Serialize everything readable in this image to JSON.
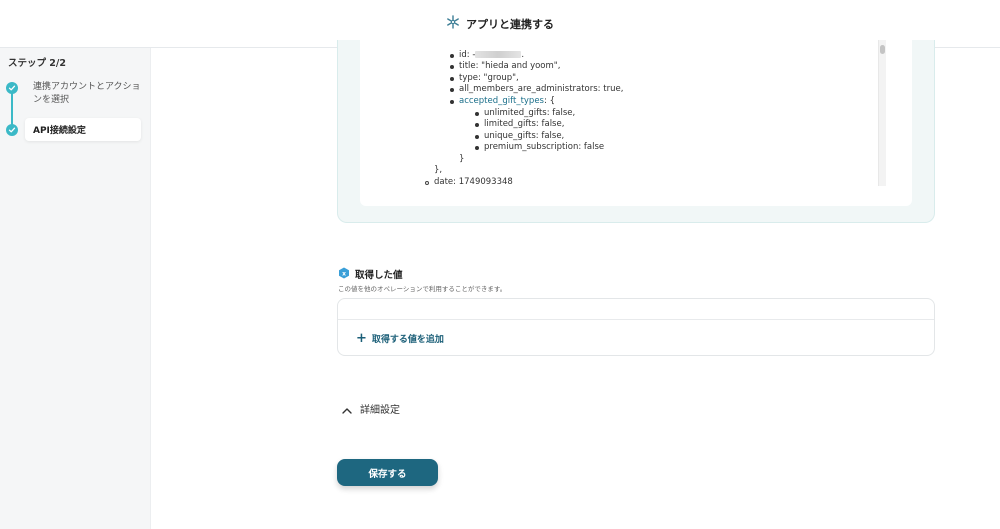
{
  "header": {
    "title": "アプリと連携する",
    "icon": "sparkle-icon"
  },
  "sidebar": {
    "step_label": "ステップ 2/2",
    "steps": [
      {
        "label": "連携アカウントとアクションを選択",
        "status": "completed"
      },
      {
        "label": "API接続設定",
        "status": "active"
      }
    ]
  },
  "code_preview": {
    "lines": [
      {
        "bullet": "filled",
        "parts": [
          {
            "text": "id: -"
          },
          {
            "blur": true
          },
          {
            "text": "."
          }
        ]
      },
      {
        "bullet": "filled",
        "parts": [
          {
            "text": "title: \"hieda and yoom\","
          }
        ]
      },
      {
        "bullet": "filled",
        "parts": [
          {
            "text": "type: \"group\","
          }
        ]
      },
      {
        "bullet": "filled",
        "parts": [
          {
            "text": "all_members_are_administrators: true,"
          }
        ]
      },
      {
        "bullet": "filled",
        "parts": [
          {
            "text": "accepted_gift_types",
            "link": true
          },
          {
            "text": ": {"
          }
        ]
      },
      {
        "bullet": "filled",
        "parts": [
          {
            "text": "unlimited_gifts: false,"
          }
        ]
      },
      {
        "bullet": "filled",
        "parts": [
          {
            "text": "limited_gifts: false,"
          }
        ]
      },
      {
        "bullet": "filled",
        "parts": [
          {
            "text": "unique_gifts: false,"
          }
        ]
      },
      {
        "bullet": "filled",
        "parts": [
          {
            "text": "premium_subscription: false"
          }
        ]
      },
      {
        "bullet": "none",
        "parts": [
          {
            "text": "}"
          }
        ]
      },
      {
        "bullet": "none",
        "parts": [
          {
            "text": "},"
          }
        ]
      },
      {
        "bullet": "hollow",
        "parts": [
          {
            "text": "date: 1749093348"
          }
        ]
      }
    ]
  },
  "values_section": {
    "title": "取得した値",
    "description": "この値を他のオペレーションで利用することができます。",
    "add_label": "取得する値を追加"
  },
  "advanced": {
    "label": "詳細設定"
  },
  "save_button": {
    "label": "保存する"
  },
  "colors": {
    "accent": "#3bb9c7",
    "primary": "#1e6780",
    "link": "#1b6f8a"
  }
}
